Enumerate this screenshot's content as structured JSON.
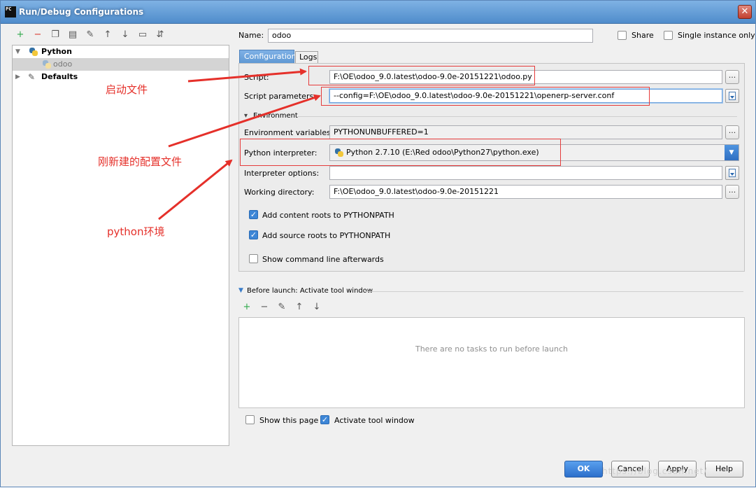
{
  "window": {
    "title": "Run/Debug Configurations",
    "app_icon_text": "PC",
    "close_glyph": "✕"
  },
  "toolbar": {
    "icons": [
      {
        "name": "add-icon",
        "glyph": "+",
        "color": "#2ea84a"
      },
      {
        "name": "remove-icon",
        "glyph": "−",
        "color": "#d9372d"
      },
      {
        "name": "copy-icon",
        "glyph": "❐"
      },
      {
        "name": "save-icon",
        "glyph": "▤"
      },
      {
        "name": "edit-defaults-icon",
        "glyph": "✎"
      },
      {
        "name": "move-up-icon",
        "glyph": "↑"
      },
      {
        "name": "move-down-icon",
        "glyph": "↓"
      },
      {
        "name": "folder-icon",
        "glyph": "▭"
      },
      {
        "name": "sort-icon",
        "glyph": "⇵"
      }
    ]
  },
  "tree": {
    "items": [
      {
        "label": "Python",
        "expanded": true
      },
      {
        "label": "odoo",
        "selected": true
      },
      {
        "label": "Defaults",
        "expanded": false
      }
    ],
    "expanded_glyph": "▼",
    "collapsed_glyph": "▶"
  },
  "form": {
    "name_label": "Name:",
    "name_value": "odoo",
    "share_label": "Share",
    "share_checked": false,
    "single_instance_label": "Single instance only",
    "single_instance_checked": false
  },
  "tabs": [
    {
      "label": "Configuration",
      "active": true
    },
    {
      "label": "Logs",
      "active": false
    }
  ],
  "config": {
    "script_label": "Script:",
    "script_value": "F:\\OE\\odoo_9.0.latest\\odoo-9.0e-20151221\\odoo.py",
    "script_params_label": "Script parameters:",
    "script_params_value": "--config=F:\\OE\\odoo_9.0.latest\\odoo-9.0e-20151221\\openerp-server.conf",
    "environment_section": "Environment",
    "env_vars_label": "Environment variables:",
    "env_vars_value": "PYTHONUNBUFFERED=1",
    "interpreter_label": "Python interpreter:",
    "interpreter_value": "Python 2.7.10 (E:\\Red odoo\\Python27\\python.exe)",
    "interpreter_options_label": "Interpreter options:",
    "interpreter_options_value": "",
    "working_dir_label": "Working directory:",
    "working_dir_value": "F:\\OE\\odoo_9.0.latest\\odoo-9.0e-20151221",
    "add_content_roots_label": "Add content roots to PYTHONPATH",
    "add_content_roots_checked": true,
    "add_source_roots_label": "Add source roots to PYTHONPATH",
    "add_source_roots_checked": true,
    "show_cmd_label": "Show command line afterwards",
    "show_cmd_checked": false,
    "browse_glyph": "...",
    "check_glyph": "✓"
  },
  "before_launch": {
    "title": "Before launch: Activate tool window",
    "empty_message": "There are no tasks to run before launch",
    "icons": [
      {
        "name": "add-task-icon",
        "glyph": "+",
        "color": "#2ea84a"
      },
      {
        "name": "remove-task-icon",
        "glyph": "−"
      },
      {
        "name": "edit-task-icon",
        "glyph": "✎"
      },
      {
        "name": "task-up-icon",
        "glyph": "↑"
      },
      {
        "name": "task-down-icon",
        "glyph": "↓"
      }
    ]
  },
  "footer": {
    "show_page_label": "Show this page",
    "show_page_checked": false,
    "activate_tool_label": "Activate tool window",
    "activate_tool_checked": true
  },
  "buttons": {
    "ok": "OK",
    "cancel": "Cancel",
    "apply": "Apply",
    "help": "Help"
  },
  "annotations": {
    "startup_file": "启动文件",
    "new_config_file": "刚新建的配置文件",
    "python_env": "python环境",
    "color": "#e5302a"
  },
  "watermark": "https://blog.csdn.net/"
}
